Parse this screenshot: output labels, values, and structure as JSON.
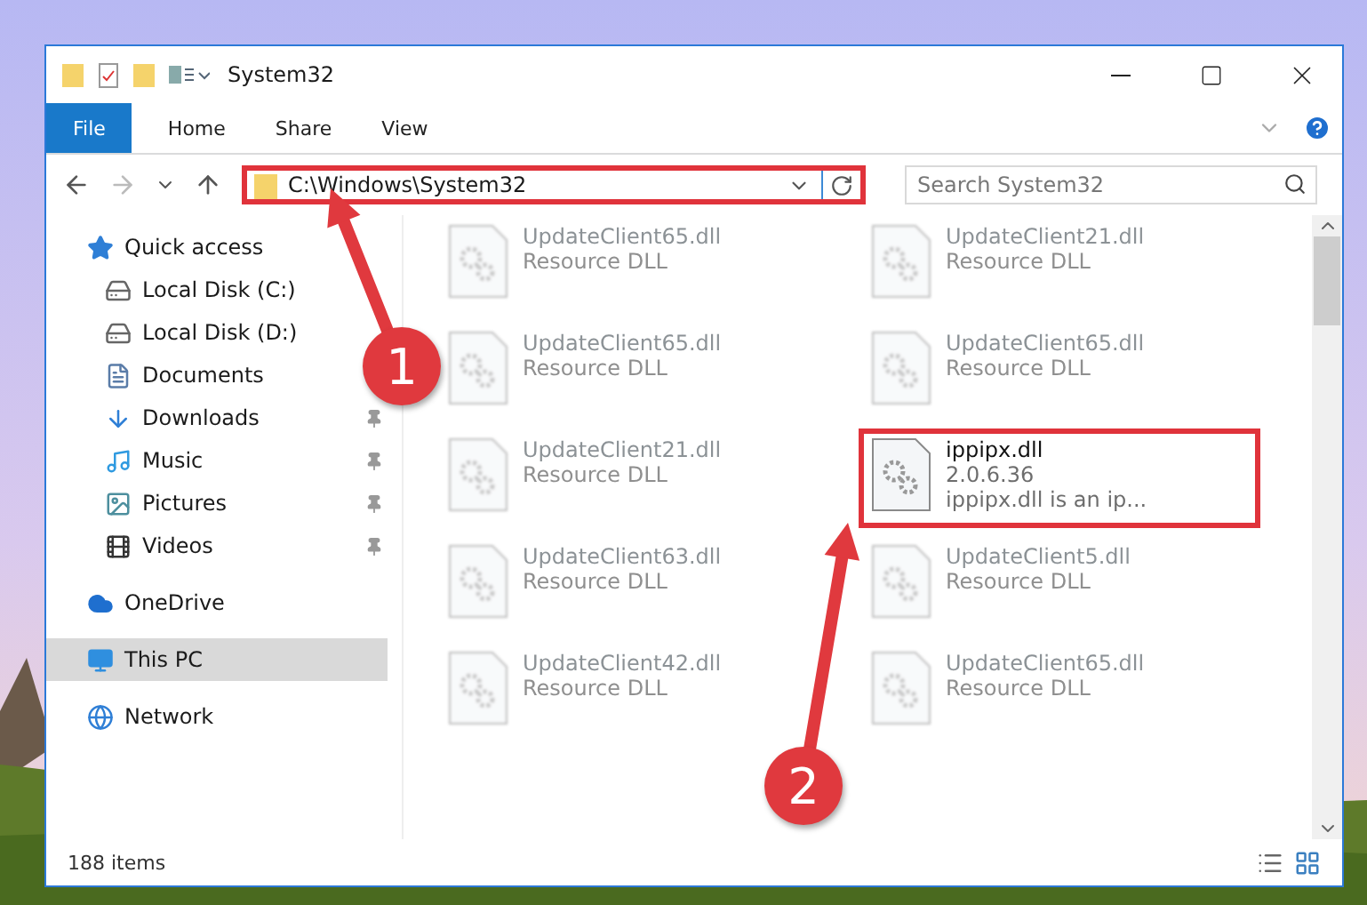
{
  "window": {
    "title": "System32"
  },
  "ribbon": {
    "tabs": [
      {
        "label": "File",
        "selected": true
      },
      {
        "label": "Home",
        "selected": false
      },
      {
        "label": "Share",
        "selected": false
      },
      {
        "label": "View",
        "selected": false
      }
    ]
  },
  "address": {
    "path": "C:\\Windows\\System32",
    "highlighted": true
  },
  "search": {
    "placeholder": "Search System32"
  },
  "sidebar": {
    "items": [
      {
        "label": "Quick access",
        "kind": "star",
        "pinned": false,
        "selected": false,
        "group": true
      },
      {
        "label": "Local Disk (C:)",
        "kind": "disk-c",
        "pinned": false,
        "selected": false,
        "group": false
      },
      {
        "label": "Local Disk (D:)",
        "kind": "disk",
        "pinned": false,
        "selected": false,
        "group": false
      },
      {
        "label": "Documents",
        "kind": "documents",
        "pinned": false,
        "selected": false,
        "group": false
      },
      {
        "label": "Downloads",
        "kind": "downloads",
        "pinned": true,
        "selected": false,
        "group": false
      },
      {
        "label": "Music",
        "kind": "music",
        "pinned": true,
        "selected": false,
        "group": false
      },
      {
        "label": "Pictures",
        "kind": "pictures",
        "pinned": true,
        "selected": false,
        "group": false
      },
      {
        "label": "Videos",
        "kind": "videos",
        "pinned": true,
        "selected": false,
        "group": false
      },
      {
        "label": "OneDrive",
        "kind": "cloud",
        "pinned": false,
        "selected": false,
        "group": true
      },
      {
        "label": "This PC",
        "kind": "pc",
        "pinned": false,
        "selected": true,
        "group": true
      },
      {
        "label": "Network",
        "kind": "network",
        "pinned": false,
        "selected": false,
        "group": true
      }
    ]
  },
  "files": [
    {
      "name": "UpdateClient65.dll",
      "lines": [
        "Resource DLL"
      ],
      "blurred": true,
      "highlighted": false
    },
    {
      "name": "UpdateClient21.dll",
      "lines": [
        "Resource DLL"
      ],
      "blurred": true,
      "highlighted": false
    },
    {
      "name": "UpdateClient65.dll",
      "lines": [
        "Resource DLL"
      ],
      "blurred": true,
      "highlighted": false
    },
    {
      "name": "UpdateClient65.dll",
      "lines": [
        "Resource DLL"
      ],
      "blurred": true,
      "highlighted": false
    },
    {
      "name": "UpdateClient21.dll",
      "lines": [
        "Resource DLL"
      ],
      "blurred": true,
      "highlighted": false
    },
    {
      "name": "ippipx.dll",
      "lines": [
        "2.0.6.36",
        "ippipx.dll is an ip..."
      ],
      "blurred": false,
      "highlighted": true
    },
    {
      "name": "UpdateClient63.dll",
      "lines": [
        "Resource DLL"
      ],
      "blurred": true,
      "highlighted": false
    },
    {
      "name": "UpdateClient5.dll",
      "lines": [
        "Resource DLL"
      ],
      "blurred": true,
      "highlighted": false
    },
    {
      "name": "UpdateClient42.dll",
      "lines": [
        "Resource DLL"
      ],
      "blurred": true,
      "highlighted": false
    },
    {
      "name": "UpdateClient65.dll",
      "lines": [
        "Resource DLL"
      ],
      "blurred": true,
      "highlighted": false
    }
  ],
  "status_bar": {
    "count": "188 items"
  },
  "annotations": [
    {
      "label": "1"
    },
    {
      "label": "2"
    }
  ]
}
